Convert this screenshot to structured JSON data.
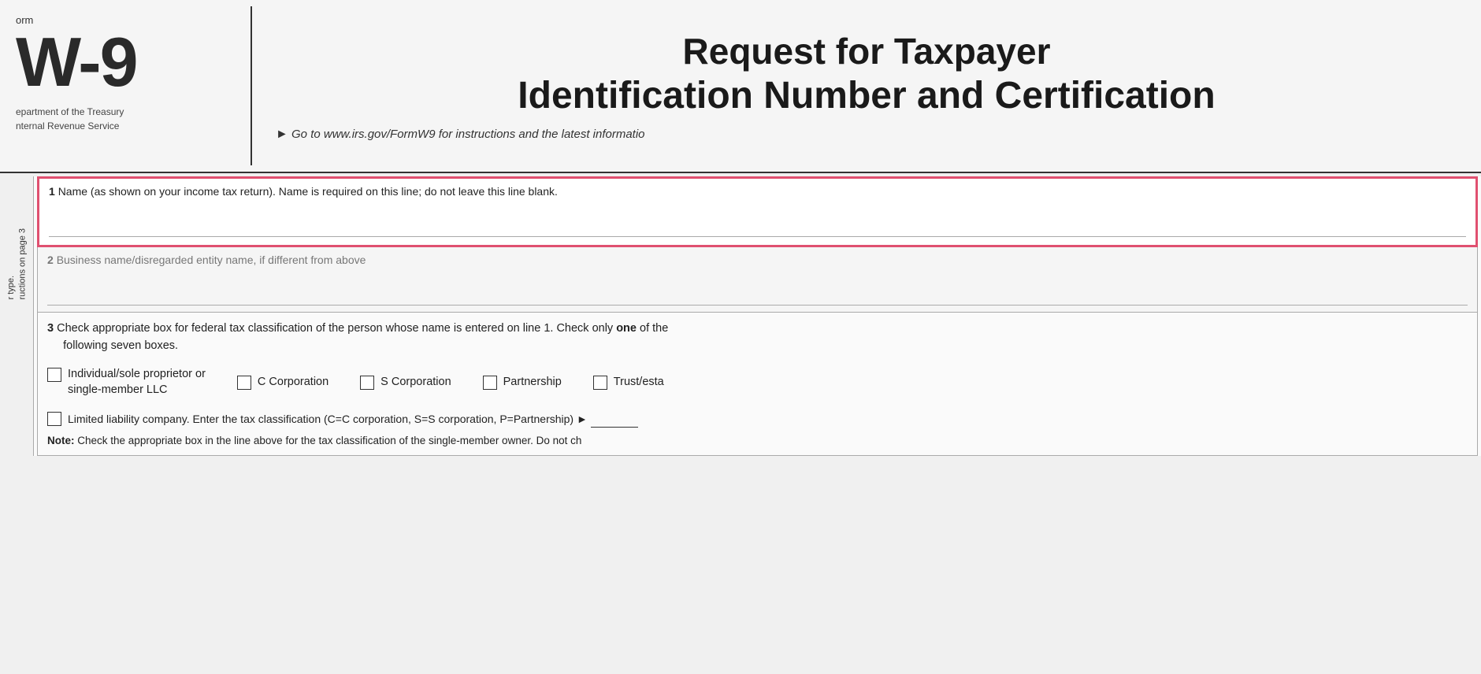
{
  "header": {
    "form_prefix": "orm",
    "form_number": "W-9",
    "dept_line1": "epartment of the Treasury",
    "dept_line2": "nternal Revenue Service",
    "title_line1": "Request for Taxpayer",
    "title_line2": "Identification Number and Certification",
    "url_text": "Go to www.irs.gov/FormW9 for instructions and the latest informatio"
  },
  "sidebar": {
    "line1": "r type.",
    "line2": "ructions on page 3"
  },
  "fields": {
    "field1": {
      "number": "1",
      "label": "Name (as shown on your income tax return). Name is required on this line; do not leave this line blank."
    },
    "field2": {
      "number": "2",
      "label": "Business name/disregarded entity name, if different from above"
    },
    "field3": {
      "number": "3",
      "label_start": "Check appropriate box for federal tax classification of the person whose name is entered on line 1. Check only",
      "label_bold": "one",
      "label_end": "of the following seven boxes.",
      "checkboxes": [
        {
          "id": "individual",
          "label_line1": "Individual/sole proprietor or",
          "label_line2": "single-member LLC"
        },
        {
          "id": "c_corp",
          "label_line1": "C Corporation",
          "label_line2": ""
        },
        {
          "id": "s_corp",
          "label_line1": "S Corporation",
          "label_line2": ""
        },
        {
          "id": "partnership",
          "label_line1": "Partnership",
          "label_line2": ""
        },
        {
          "id": "trust",
          "label_line1": "Trust/esta",
          "label_line2": ""
        }
      ],
      "llc_label": "Limited liability company. Enter the tax classification (C=C corporation, S=S corporation, P=Partnership) ►",
      "note_bold": "Note:",
      "note_text": "Check the appropriate box in the line above for the tax classification of the single-member owner.  Do not ch"
    }
  }
}
